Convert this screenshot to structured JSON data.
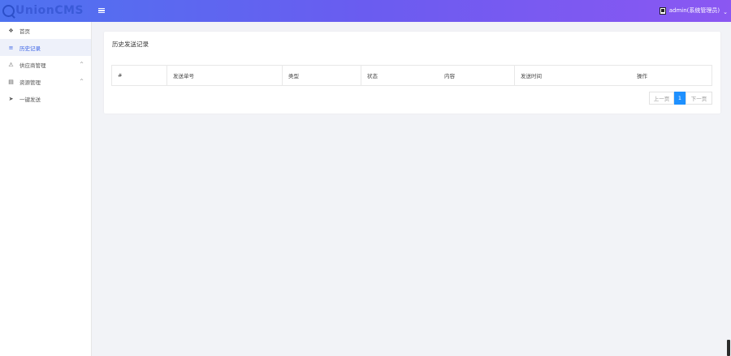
{
  "header": {
    "logo_text": "UnionCMS",
    "menu_icon": "hamburger-icon",
    "user_name": "admin(系统管理员)",
    "user_caret": "⌄"
  },
  "sidebar": {
    "items": [
      {
        "label": "首页",
        "icon": "home-icon",
        "glyph": "❖"
      },
      {
        "label": "历史记录",
        "icon": "list-icon",
        "glyph": "≡",
        "active": true
      },
      {
        "label": "供应商管理",
        "icon": "sitemap-icon",
        "glyph": "⚠",
        "arrow": "^"
      },
      {
        "label": "资源管理",
        "icon": "database-icon",
        "glyph": "▤",
        "arrow": "^"
      },
      {
        "label": "一键发送",
        "icon": "send-icon",
        "glyph": "➤"
      }
    ]
  },
  "main": {
    "title": "历史发送记录",
    "table": {
      "columns": [
        "#",
        "发送单号",
        "类型",
        "状态",
        "内容",
        "发送时间",
        "操作"
      ]
    },
    "pagination": {
      "prev": "上一页",
      "current": "1",
      "next": "下一页"
    }
  },
  "colors": {
    "header_start": "#4e73f0",
    "header_end": "#8b57f2",
    "accent": "#1e90ff",
    "active_nav": "#3b63e6"
  }
}
